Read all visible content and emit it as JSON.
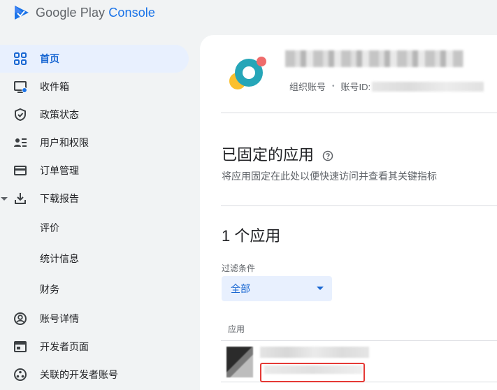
{
  "header": {
    "brand_google_play": "Google Play",
    "brand_console": "Console"
  },
  "sidebar": {
    "items": [
      {
        "label": "首页",
        "icon": "dashboard-grid-icon",
        "active": true
      },
      {
        "label": "收件箱",
        "icon": "inbox-icon"
      },
      {
        "label": "政策状态",
        "icon": "shield-check-icon"
      },
      {
        "label": "用户和权限",
        "icon": "users-list-icon"
      },
      {
        "label": "订单管理",
        "icon": "credit-card-icon"
      },
      {
        "label": "下载报告",
        "icon": "download-icon",
        "expanded": true
      },
      {
        "label": "评价",
        "sub": true
      },
      {
        "label": "统计信息",
        "sub": true
      },
      {
        "label": "财务",
        "sub": true
      },
      {
        "label": "账号详情",
        "icon": "account-circle-icon"
      },
      {
        "label": "开发者页面",
        "icon": "web-page-icon"
      },
      {
        "label": "关联的开发者账号",
        "icon": "linked-accounts-icon"
      }
    ]
  },
  "account": {
    "org_label": "组织账号",
    "account_id_label": "账号ID:"
  },
  "pinned": {
    "title": "已固定的应用",
    "subtitle": "将应用固定在此处以便快速访问并查看其关键指标"
  },
  "apps": {
    "count_title": "1 个应用",
    "filter_label": "过滤条件",
    "filter_value": "全部",
    "column_header": "应用"
  },
  "colors": {
    "accent": "#1967d2",
    "active_bg": "#e8f0fe",
    "highlight": "#e53935"
  }
}
